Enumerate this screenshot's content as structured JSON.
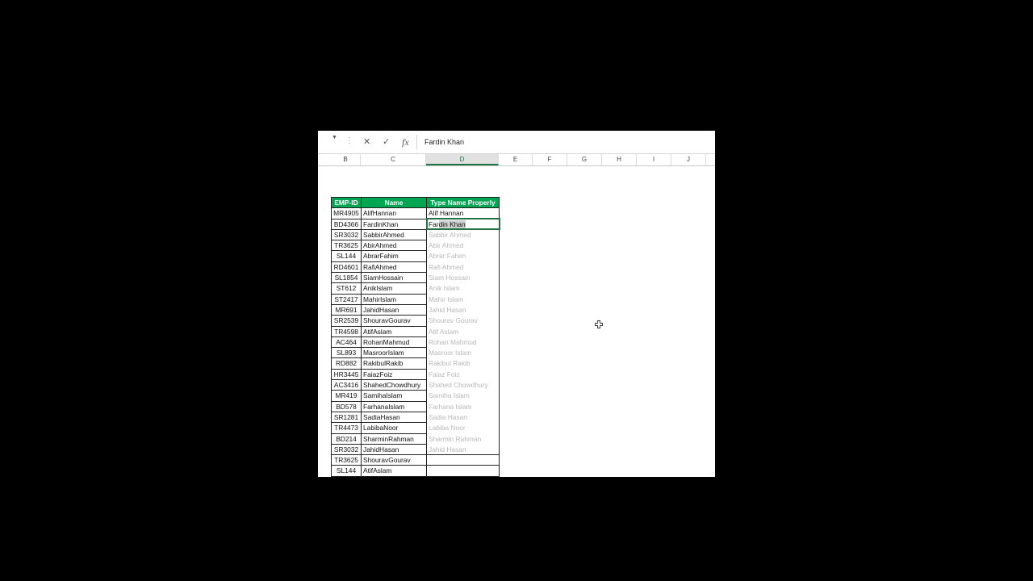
{
  "formula_bar": {
    "name_box_value": "",
    "cancel_icon": "x-icon",
    "enter_icon": "check-icon",
    "fx_label": "fx",
    "value": "Fardin Khan"
  },
  "columns": [
    "B",
    "C",
    "D",
    "E",
    "F",
    "G",
    "H",
    "I",
    "J"
  ],
  "selected_column": "D",
  "table": {
    "headers": [
      "EMP-ID",
      "Name",
      "Type Name Properly"
    ],
    "rows": [
      {
        "id": "MR4905",
        "name": "AlifHannan",
        "typed": "Alif Hannan"
      },
      {
        "id": "BD4366",
        "name": "FardinKhan",
        "typed_pre": "Far",
        "typed_hl": "din Khan"
      },
      {
        "id": "SR3032",
        "name": "SabbirAhmed",
        "typed": "Sabbir Ahmed"
      },
      {
        "id": "TR3625",
        "name": "AbirAhmed",
        "typed": "Abir Ahmed"
      },
      {
        "id": "SL144",
        "name": "AbrarFahim",
        "typed": "Abrar Fahim"
      },
      {
        "id": "RD4601",
        "name": "RafiAhmed",
        "typed": "Rafi Ahmed"
      },
      {
        "id": "SL1854",
        "name": "SiamHossain",
        "typed": "Siam Hossain"
      },
      {
        "id": "ST612",
        "name": "AnikIslam",
        "typed": "Anik Islam"
      },
      {
        "id": "ST2417",
        "name": "MahirIslam",
        "typed": "Mahir Islam"
      },
      {
        "id": "MR691",
        "name": "JahidHasan",
        "typed": "Jahid Hasan"
      },
      {
        "id": "SR2539",
        "name": "ShouravGourav",
        "typed": "Shourav Gourav"
      },
      {
        "id": "TR4598",
        "name": "AtifAslam",
        "typed": "Atif Aslam"
      },
      {
        "id": "AC464",
        "name": "RohanMahmud",
        "typed": "Rohan Mahmud"
      },
      {
        "id": "SL893",
        "name": "MasroorIslam",
        "typed": "Masroor Islam"
      },
      {
        "id": "RD882",
        "name": "RakibulRakib",
        "typed": "Rakibul Rakib"
      },
      {
        "id": "HR3445",
        "name": "FaiazFoiz",
        "typed": "Faiaz Foiz"
      },
      {
        "id": "AC3416",
        "name": "ShahedChowdhury",
        "typed": "Shahed Chowdhury"
      },
      {
        "id": "MR419",
        "name": "SamihaIslam",
        "typed": "Samiha Islam"
      },
      {
        "id": "BD578",
        "name": "FarhanaIslam",
        "typed": "Farhana Islam"
      },
      {
        "id": "SR1281",
        "name": "SadiaHasan",
        "typed": "Sadia Hasan"
      },
      {
        "id": "TR4473",
        "name": "LabibaNoor",
        "typed": "Labiba Noor"
      },
      {
        "id": "BD214",
        "name": "SharminRahman",
        "typed": "Sharmin Rahman"
      },
      {
        "id": "SR3032",
        "name": "JahidHasan",
        "typed": "Jahid Hasan"
      },
      {
        "id": "TR3625",
        "name": "ShouravGourav",
        "typed": ""
      },
      {
        "id": "SL144",
        "name": "AtifAslam",
        "typed": ""
      }
    ]
  },
  "colors": {
    "header_green": "#00a651",
    "selection_green": "#217346",
    "suggestion_gray": "#b8b8b8"
  }
}
